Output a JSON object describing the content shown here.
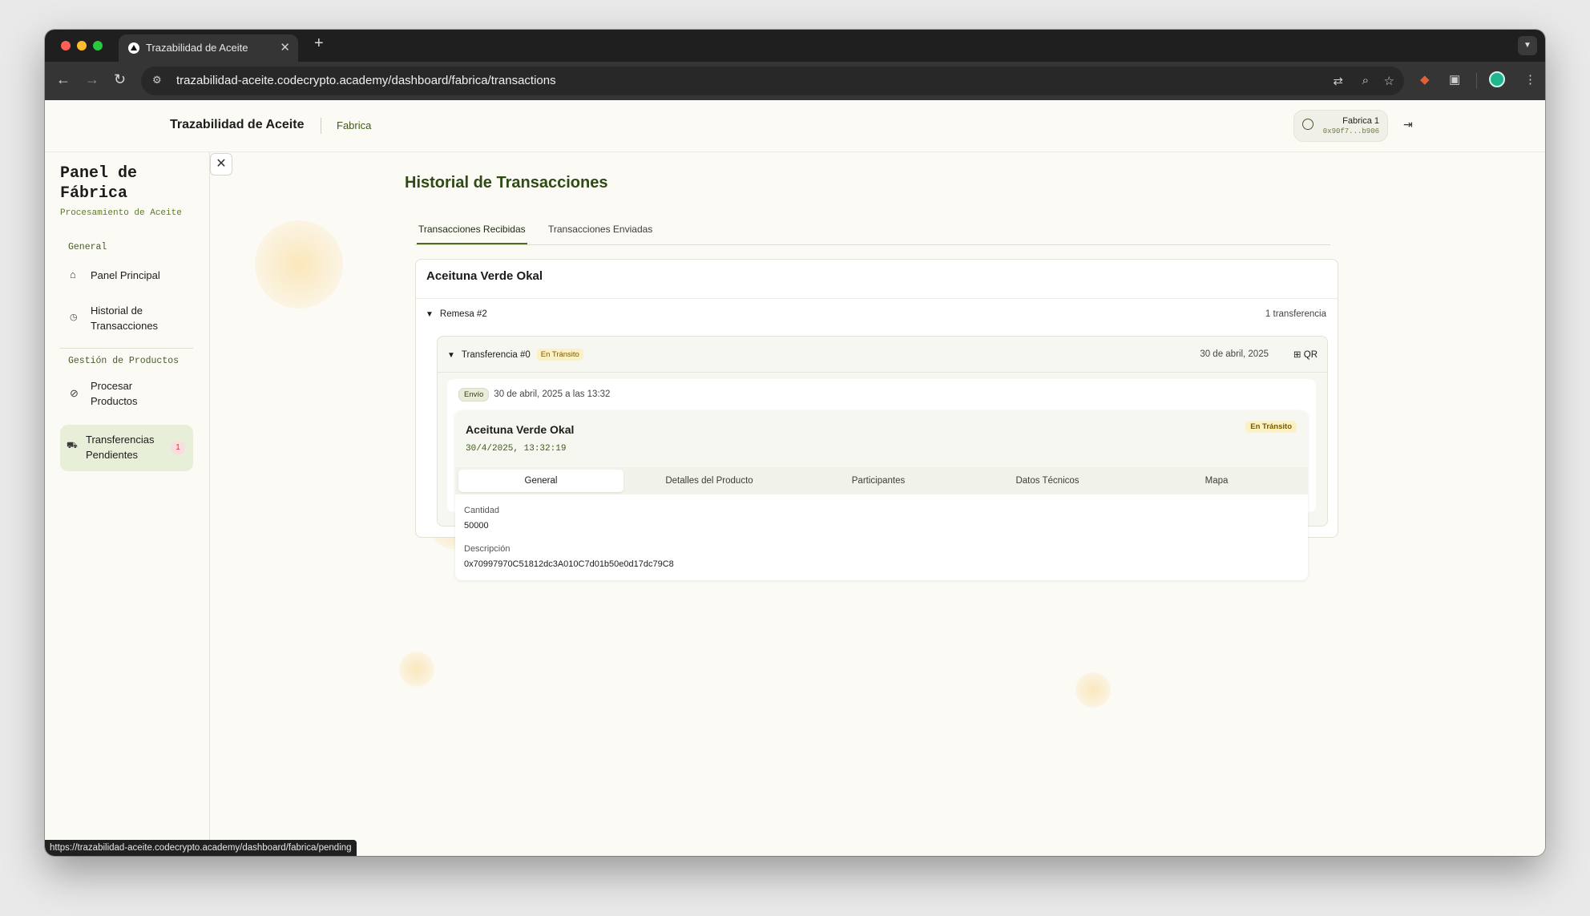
{
  "browser": {
    "tab_title": "Trazabilidad de Aceite",
    "tab_close": "✕",
    "new_tab": "+",
    "address": "trazabilidad-aceite.codecrypto.academy/dashboard/fabrica/transactions",
    "status_url": "https://trazabilidad-aceite.codecrypto.academy/dashboard/fabrica/pending"
  },
  "header": {
    "brand": "Trazabilidad de Aceite",
    "role": "Fabrica",
    "account_name": "Fabrica 1",
    "account_address": "0x90f7...b906"
  },
  "sidebar": {
    "title": "Panel de Fábrica",
    "subtitle": "Procesamiento de Aceite",
    "section_general": "General",
    "section_products": "Gestión de Productos",
    "items": [
      {
        "label": "Panel Principal",
        "icon": "home-icon"
      },
      {
        "label": "Historial de Transacciones",
        "icon": "clock-icon"
      },
      {
        "label": "Procesar Productos",
        "icon": "process-icon"
      },
      {
        "label": "Transferencias Pendientes",
        "icon": "truck-icon",
        "badge": "1"
      }
    ]
  },
  "main": {
    "title": "Historial de Transacciones",
    "tabs": [
      {
        "label": "Transacciones Recibidas"
      },
      {
        "label": "Transacciones Enviadas"
      }
    ],
    "product": "Aceituna Verde Okal",
    "remesa": {
      "label": "Remesa #2",
      "count": "1 transferencia"
    },
    "transfer": {
      "label": "Transferencia #0",
      "status": "En Tránsito",
      "date": "30 de abril, 2025",
      "qr_label": "QR",
      "envio_tag": "Envío",
      "envio_date": "30 de abril, 2025 a las 13:32",
      "detail": {
        "title": "Aceituna Verde Okal",
        "timestamp": "30/4/2025, 13:32:19",
        "status": "En Tránsito",
        "tabs": [
          "General",
          "Detalles del Producto",
          "Participantes",
          "Datos Técnicos",
          "Mapa"
        ],
        "cantidad_label": "Cantidad",
        "cantidad_value": "50000",
        "descripcion_label": "Descripción",
        "descripcion_value": "0x70997970C51812dc3A010C7d01b50e0d17dc79C8"
      }
    }
  },
  "colors": {
    "accent": "#2f4a14",
    "status_yellow": "#fbf1c4",
    "active_sidebar": "#e7efd8"
  }
}
